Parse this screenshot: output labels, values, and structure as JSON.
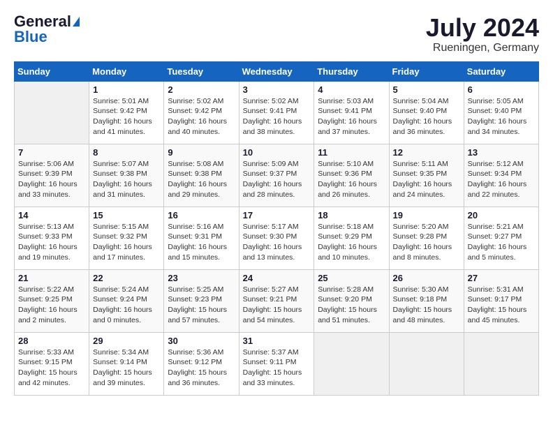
{
  "header": {
    "logo_general": "General",
    "logo_blue": "Blue",
    "month_year": "July 2024",
    "location": "Rueningen, Germany"
  },
  "columns": [
    "Sunday",
    "Monday",
    "Tuesday",
    "Wednesday",
    "Thursday",
    "Friday",
    "Saturday"
  ],
  "weeks": [
    [
      {
        "day": "",
        "info": ""
      },
      {
        "day": "1",
        "info": "Sunrise: 5:01 AM\nSunset: 9:42 PM\nDaylight: 16 hours\nand 41 minutes."
      },
      {
        "day": "2",
        "info": "Sunrise: 5:02 AM\nSunset: 9:42 PM\nDaylight: 16 hours\nand 40 minutes."
      },
      {
        "day": "3",
        "info": "Sunrise: 5:02 AM\nSunset: 9:41 PM\nDaylight: 16 hours\nand 38 minutes."
      },
      {
        "day": "4",
        "info": "Sunrise: 5:03 AM\nSunset: 9:41 PM\nDaylight: 16 hours\nand 37 minutes."
      },
      {
        "day": "5",
        "info": "Sunrise: 5:04 AM\nSunset: 9:40 PM\nDaylight: 16 hours\nand 36 minutes."
      },
      {
        "day": "6",
        "info": "Sunrise: 5:05 AM\nSunset: 9:40 PM\nDaylight: 16 hours\nand 34 minutes."
      }
    ],
    [
      {
        "day": "7",
        "info": "Sunrise: 5:06 AM\nSunset: 9:39 PM\nDaylight: 16 hours\nand 33 minutes."
      },
      {
        "day": "8",
        "info": "Sunrise: 5:07 AM\nSunset: 9:38 PM\nDaylight: 16 hours\nand 31 minutes."
      },
      {
        "day": "9",
        "info": "Sunrise: 5:08 AM\nSunset: 9:38 PM\nDaylight: 16 hours\nand 29 minutes."
      },
      {
        "day": "10",
        "info": "Sunrise: 5:09 AM\nSunset: 9:37 PM\nDaylight: 16 hours\nand 28 minutes."
      },
      {
        "day": "11",
        "info": "Sunrise: 5:10 AM\nSunset: 9:36 PM\nDaylight: 16 hours\nand 26 minutes."
      },
      {
        "day": "12",
        "info": "Sunrise: 5:11 AM\nSunset: 9:35 PM\nDaylight: 16 hours\nand 24 minutes."
      },
      {
        "day": "13",
        "info": "Sunrise: 5:12 AM\nSunset: 9:34 PM\nDaylight: 16 hours\nand 22 minutes."
      }
    ],
    [
      {
        "day": "14",
        "info": "Sunrise: 5:13 AM\nSunset: 9:33 PM\nDaylight: 16 hours\nand 19 minutes."
      },
      {
        "day": "15",
        "info": "Sunrise: 5:15 AM\nSunset: 9:32 PM\nDaylight: 16 hours\nand 17 minutes."
      },
      {
        "day": "16",
        "info": "Sunrise: 5:16 AM\nSunset: 9:31 PM\nDaylight: 16 hours\nand 15 minutes."
      },
      {
        "day": "17",
        "info": "Sunrise: 5:17 AM\nSunset: 9:30 PM\nDaylight: 16 hours\nand 13 minutes."
      },
      {
        "day": "18",
        "info": "Sunrise: 5:18 AM\nSunset: 9:29 PM\nDaylight: 16 hours\nand 10 minutes."
      },
      {
        "day": "19",
        "info": "Sunrise: 5:20 AM\nSunset: 9:28 PM\nDaylight: 16 hours\nand 8 minutes."
      },
      {
        "day": "20",
        "info": "Sunrise: 5:21 AM\nSunset: 9:27 PM\nDaylight: 16 hours\nand 5 minutes."
      }
    ],
    [
      {
        "day": "21",
        "info": "Sunrise: 5:22 AM\nSunset: 9:25 PM\nDaylight: 16 hours\nand 2 minutes."
      },
      {
        "day": "22",
        "info": "Sunrise: 5:24 AM\nSunset: 9:24 PM\nDaylight: 16 hours\nand 0 minutes."
      },
      {
        "day": "23",
        "info": "Sunrise: 5:25 AM\nSunset: 9:23 PM\nDaylight: 15 hours\nand 57 minutes."
      },
      {
        "day": "24",
        "info": "Sunrise: 5:27 AM\nSunset: 9:21 PM\nDaylight: 15 hours\nand 54 minutes."
      },
      {
        "day": "25",
        "info": "Sunrise: 5:28 AM\nSunset: 9:20 PM\nDaylight: 15 hours\nand 51 minutes."
      },
      {
        "day": "26",
        "info": "Sunrise: 5:30 AM\nSunset: 9:18 PM\nDaylight: 15 hours\nand 48 minutes."
      },
      {
        "day": "27",
        "info": "Sunrise: 5:31 AM\nSunset: 9:17 PM\nDaylight: 15 hours\nand 45 minutes."
      }
    ],
    [
      {
        "day": "28",
        "info": "Sunrise: 5:33 AM\nSunset: 9:15 PM\nDaylight: 15 hours\nand 42 minutes."
      },
      {
        "day": "29",
        "info": "Sunrise: 5:34 AM\nSunset: 9:14 PM\nDaylight: 15 hours\nand 39 minutes."
      },
      {
        "day": "30",
        "info": "Sunrise: 5:36 AM\nSunset: 9:12 PM\nDaylight: 15 hours\nand 36 minutes."
      },
      {
        "day": "31",
        "info": "Sunrise: 5:37 AM\nSunset: 9:11 PM\nDaylight: 15 hours\nand 33 minutes."
      },
      {
        "day": "",
        "info": ""
      },
      {
        "day": "",
        "info": ""
      },
      {
        "day": "",
        "info": ""
      }
    ]
  ]
}
